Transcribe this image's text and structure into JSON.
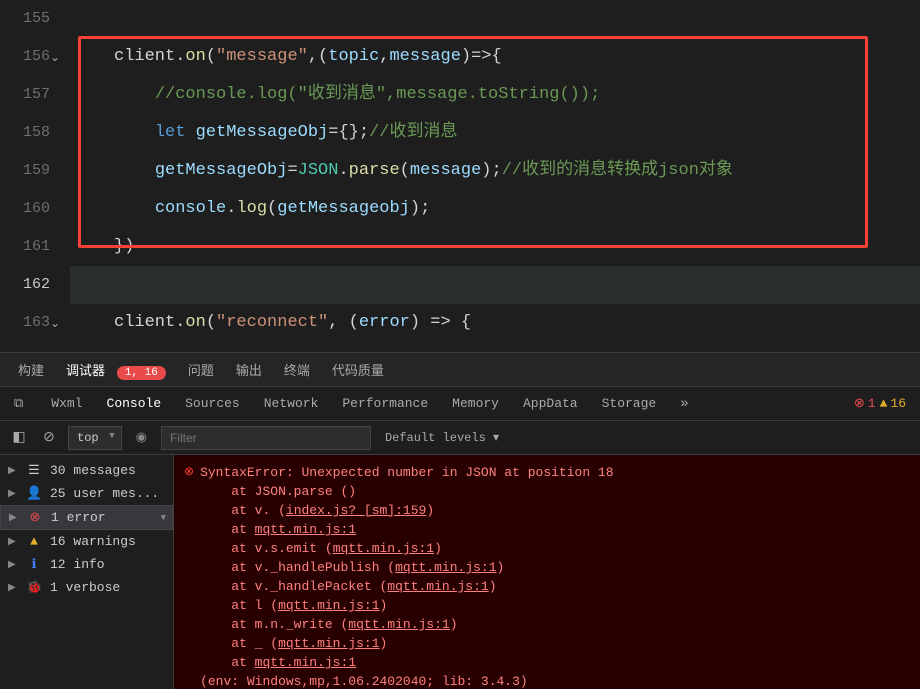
{
  "editor": {
    "lines": [
      {
        "num": "155",
        "html": ""
      },
      {
        "num": "156",
        "fold": true,
        "html": "client.<span class='t-method'>on</span>(<span class='t-string'>\"message\"</span>,(<span class='t-param'>topic</span>,<span class='t-param'>message</span>)=&gt;{"
      },
      {
        "num": "157",
        "html": "    <span class='t-comment'>//console.log(\"收到消息\",message.toString());</span>"
      },
      {
        "num": "158",
        "html": "    <span class='t-keyword'>let</span> <span class='t-ident'>getMessageObj</span>={};<span class='t-comment'>//收到消息</span>"
      },
      {
        "num": "159",
        "html": "    <span class='t-ident'>getMessageObj</span>=<span class='t-class'>JSON</span>.<span class='t-method'>parse</span>(<span class='t-ident'>message</span>);<span class='t-comment'>//收到的消息转换成json对象</span>"
      },
      {
        "num": "160",
        "html": "    <span class='t-ident'>console</span>.<span class='t-method'>log</span>(<span class='t-ident'>getMessageobj</span>);"
      },
      {
        "num": "161",
        "html": "})"
      },
      {
        "num": "162",
        "active": true,
        "html": ""
      },
      {
        "num": "163",
        "fold": true,
        "html": "client.<span class='t-method'>on</span>(<span class='t-string'>\"reconnect\"</span>, (<span class='t-param'>error</span>) =&gt; {"
      }
    ]
  },
  "tabs1": {
    "build": "构建",
    "debugger": "调试器",
    "badge": "1, 16",
    "problems": "问题",
    "output": "输出",
    "terminal": "终端",
    "quality": "代码质量"
  },
  "tabs2": {
    "wxml": "Wxml",
    "console": "Console",
    "sources": "Sources",
    "network": "Network",
    "performance": "Performance",
    "memory": "Memory",
    "appdata": "AppData",
    "storage": "Storage",
    "err": "1",
    "warn": "16"
  },
  "controls": {
    "context": "top",
    "filter_ph": "Filter",
    "levels": "Default levels ▾"
  },
  "sidebar": {
    "messages": "30 messages",
    "usermes": "25 user mes...",
    "error": "1 error",
    "warnings": "16 warnings",
    "info": "12 info",
    "verbose": "1 verbose"
  },
  "error": {
    "title": "SyntaxError: Unexpected number in JSON at position 18",
    "lines": [
      "at JSON.parse (<anonymous>)",
      "at v.<anonymous> (<span class='ul'>index.js? [sm]:159</span>)",
      "at <span class='ul'>mqtt.min.js:1</span>",
      "at v.s.emit (<span class='ul'>mqtt.min.js:1</span>)",
      "at v._handlePublish (<span class='ul'>mqtt.min.js:1</span>)",
      "at v._handlePacket (<span class='ul'>mqtt.min.js:1</span>)",
      "at l (<span class='ul'>mqtt.min.js:1</span>)",
      "at m.n._write (<span class='ul'>mqtt.min.js:1</span>)",
      "at _ (<span class='ul'>mqtt.min.js:1</span>)",
      "at <span class='ul'>mqtt.min.js:1</span>"
    ],
    "env": "(env: Windows,mp,1.06.2402040; lib: 3.4.3)"
  }
}
